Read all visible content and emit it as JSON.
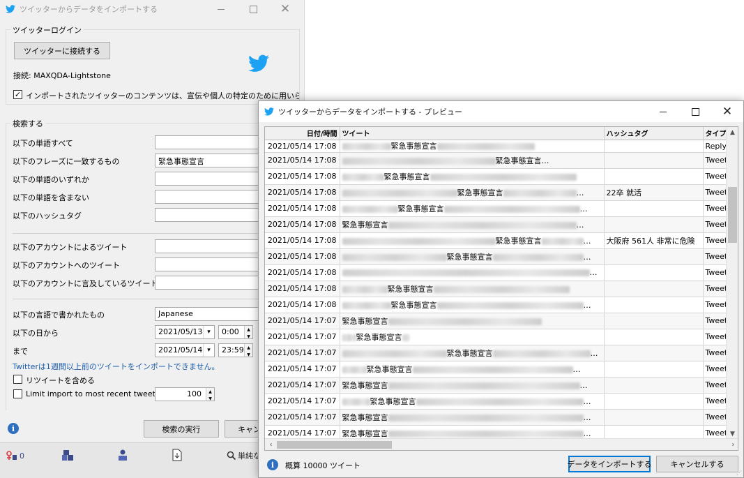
{
  "main_window": {
    "title": "ツイッターからデータをインポートする",
    "login_group": {
      "legend": "ツイッターログイン",
      "connect_button": "ツイッターに接続する",
      "connection_status": "接続: MAXQDA-Lightstone",
      "consent_checked": "✓",
      "consent_text": "インポートされたツイッターのコンテンツは、宣伝や個人の特定のために用いられてはい"
    },
    "search_group": {
      "legend": "検索する",
      "all_words": {
        "label": "以下の単語すべて",
        "value": ""
      },
      "exact_phrase": {
        "label": "以下のフレーズに一致するもの",
        "value": "緊急事態宣言"
      },
      "any_words": {
        "label": "以下の単語のいずれか",
        "value": ""
      },
      "none_words": {
        "label": "以下の単語を含まない",
        "value": ""
      },
      "hashtags": {
        "label": "以下のハッシュタグ",
        "value": ""
      },
      "from_account": {
        "label": "以下のアカウントによるツイート",
        "value": ""
      },
      "to_account": {
        "label": "以下のアカウントへのツイート",
        "value": ""
      },
      "mention_account": {
        "label": "以下のアカウントに言及しているツイート",
        "value": ""
      },
      "language": {
        "label": "以下の言語で書かれたもの",
        "value": "Japanese"
      },
      "since": {
        "label": "以下の日から",
        "date": "2021/05/13",
        "time": "0:00"
      },
      "until": {
        "label": "まで",
        "date": "2021/05/14",
        "time": "23:59"
      },
      "note": "Twitterは1週間以上前のツイートをインポートできません。",
      "include_retweets": "リツイートを含める",
      "limit_recent": {
        "label": "Limit import to most recent tweets",
        "value": "100"
      }
    },
    "buttons": {
      "run_search": "検索の実行",
      "cancel_partial": "キャン"
    },
    "statusbar": {
      "counter": "0",
      "simple_partial": "単純な"
    }
  },
  "preview_window": {
    "title": "ツイッターからデータをインポートする - プレビュー",
    "columns": [
      "日付/時間",
      "ツイート",
      "ハッシュタグ",
      "タイプ"
    ],
    "rows": [
      {
        "date": "2021/05/14 17:08",
        "pre": 70,
        "keyword": "緊急事態宣言",
        "post": 140,
        "ellipsis": "",
        "hashtag": "",
        "type": "Reply"
      },
      {
        "date": "2021/05/14 17:08",
        "pre": 220,
        "keyword": "緊急事態宣言",
        "post": 0,
        "ellipsis": "…",
        "hashtag": "",
        "type": "Tweet"
      },
      {
        "date": "2021/05/14 17:08",
        "pre": 60,
        "keyword": "緊急事態宣言",
        "post": 210,
        "ellipsis": "",
        "hashtag": "",
        "type": "Tweet"
      },
      {
        "date": "2021/05/14 17:08",
        "pre": 165,
        "keyword": "緊急事態宣言",
        "post": 105,
        "ellipsis": "…",
        "hashtag": "22卒 就活",
        "type": "Tweet"
      },
      {
        "date": "2021/05/14 17:08",
        "pre": 80,
        "keyword": "緊急事態宣言",
        "post": 195,
        "ellipsis": "…",
        "hashtag": "",
        "type": "Tweet"
      },
      {
        "date": "2021/05/14 17:08",
        "pre": 0,
        "keyword": "緊急事態宣言",
        "post": 270,
        "ellipsis": "…",
        "hashtag": "",
        "type": "Tweet"
      },
      {
        "date": "2021/05/14 17:08",
        "pre": 220,
        "keyword": "緊急事態宣言",
        "post": 60,
        "ellipsis": "…",
        "hashtag": "大阪府 561人 非常に危険",
        "type": "Tweet"
      },
      {
        "date": "2021/05/14 17:08",
        "pre": 150,
        "keyword": "緊急事態宣言",
        "post": 130,
        "ellipsis": "…",
        "hashtag": "",
        "type": "Tweet"
      },
      {
        "date": "2021/05/14 17:08",
        "pre": 0,
        "keyword": "",
        "post": 355,
        "ellipsis": "…",
        "hashtag": "",
        "type": "Tweet"
      },
      {
        "date": "2021/05/14 17:08",
        "pre": 65,
        "keyword": "緊急事態宣言",
        "post": 195,
        "ellipsis": "",
        "hashtag": "",
        "type": "Tweet"
      },
      {
        "date": "2021/05/14 17:08",
        "pre": 70,
        "keyword": "緊急事態宣言",
        "post": 210,
        "ellipsis": "…",
        "hashtag": "",
        "type": "Tweet"
      },
      {
        "date": "2021/05/14 17:07",
        "pre": 0,
        "keyword": "緊急事態宣言",
        "post": 220,
        "ellipsis": "",
        "hashtag": "",
        "type": "Tweet"
      },
      {
        "date": "2021/05/14 17:07",
        "pre": 20,
        "keyword": "緊急事態宣言",
        "post": 10,
        "ellipsis": "",
        "hashtag": "",
        "type": "Tweet"
      },
      {
        "date": "2021/05/14 17:07",
        "pre": 150,
        "keyword": "緊急事態宣言",
        "post": 140,
        "ellipsis": "…",
        "hashtag": "",
        "type": "Tweet"
      },
      {
        "date": "2021/05/14 17:07",
        "pre": 35,
        "keyword": "緊急事態宣言",
        "post": 230,
        "ellipsis": "…",
        "hashtag": "",
        "type": "Tweet"
      },
      {
        "date": "2021/05/14 17:07",
        "pre": 0,
        "keyword": "緊急事態宣言",
        "post": 275,
        "ellipsis": "…",
        "hashtag": "",
        "type": "Tweet"
      },
      {
        "date": "2021/05/14 17:07",
        "pre": 40,
        "keyword": "緊急事態宣言",
        "post": 240,
        "ellipsis": "…",
        "hashtag": "",
        "type": "Tweet"
      },
      {
        "date": "2021/05/14 17:07",
        "pre": 0,
        "keyword": "緊急事態宣言",
        "post": 280,
        "ellipsis": "…",
        "hashtag": "",
        "type": "Tweet"
      },
      {
        "date": "2021/05/14 17:07",
        "pre": 0,
        "keyword": "緊急事態宣言",
        "post": 280,
        "ellipsis": "…",
        "hashtag": "",
        "type": "Tweet"
      }
    ],
    "summary": "概算 10000 ツイート",
    "import_button": "データをインポートする",
    "cancel_button": "キャンセルする"
  },
  "colors": {
    "twitter": "#1da1f2",
    "accent": "#0078d7",
    "link": "#1a5cab",
    "info": "#2f6fbf"
  },
  "icons": [
    "twitter-bird-icon",
    "minimize-icon",
    "maximize-icon",
    "close-icon",
    "checkmark-icon",
    "info-icon",
    "spinner-up-icon",
    "spinner-down-icon",
    "dropdown-arrow-icon",
    "scroll-up-icon",
    "scroll-down-icon",
    "scroll-left-icon",
    "scroll-right-icon"
  ]
}
